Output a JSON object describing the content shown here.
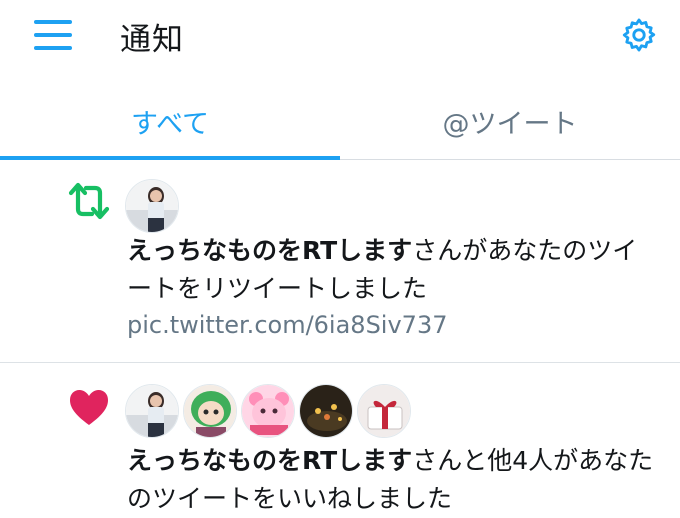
{
  "header": {
    "title": "通知",
    "menu_icon": "hamburger-menu-icon",
    "settings_icon": "gear-icon"
  },
  "tabs": [
    {
      "label": "すべて",
      "active": true
    },
    {
      "label": "@ツイート",
      "active": false
    }
  ],
  "colors": {
    "accent": "#1da1f2",
    "retweet": "#17bf63",
    "like": "#e0245e",
    "secondary_text": "#657786"
  },
  "notifications": [
    {
      "type": "retweet",
      "icon": "retweet-icon",
      "user_name": "えっちなものをRTします",
      "message": "さんがあなたのツイートをリツイートしました",
      "link": "pic.twitter.com/6ia8Siv737",
      "avatars": [
        "user-avatar"
      ]
    },
    {
      "type": "like",
      "icon": "heart-icon",
      "user_name": "えっちなものをRTします",
      "message": "さんと他4人があなたのツイートをいいねしました",
      "avatars": [
        "user-avatar",
        "user-avatar",
        "user-avatar",
        "user-avatar",
        "user-avatar"
      ]
    }
  ]
}
